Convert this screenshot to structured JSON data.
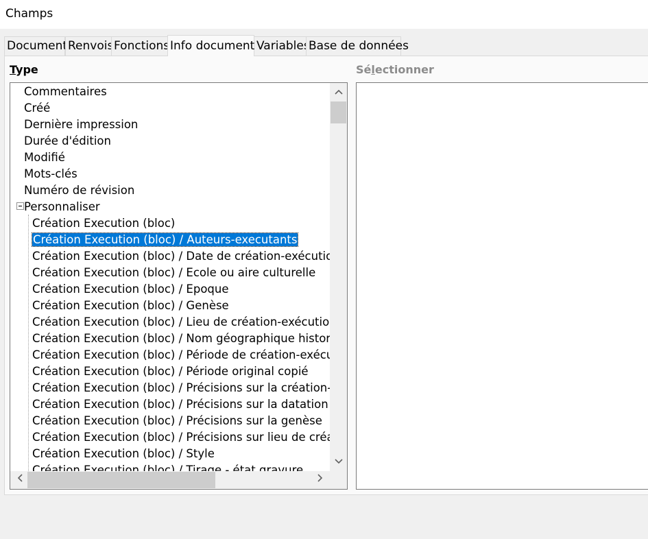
{
  "window": {
    "title": "Champs"
  },
  "tabs": [
    {
      "label": "Document"
    },
    {
      "label": "Renvois"
    },
    {
      "label": "Fonctions"
    },
    {
      "label": "Info document"
    },
    {
      "label": "Variables"
    },
    {
      "label": "Base de données"
    }
  ],
  "active_tab": "Info document",
  "type_panel": {
    "label_mnemonic": "T",
    "label_rest": "ype",
    "items": [
      "Commentaires",
      "Créé",
      "Dernière impression",
      "Durée d'édition",
      "Modifié",
      "Mots-clés",
      "Numéro de révision",
      "Personnaliser",
      "Création Execution (bloc)",
      "Création Execution (bloc) / Auteurs-executants",
      "Création Execution (bloc) / Date de création-exécution",
      "Création Execution (bloc) / Ecole ou aire culturelle",
      "Création Execution (bloc) / Epoque",
      "Création Execution (bloc) / Genèse",
      "Création Execution (bloc) / Lieu de création-exécution",
      "Création Execution (bloc) / Nom géographique historiq",
      "Création Execution (bloc) / Période de création-exécutic",
      "Création Execution (bloc) / Période original copié",
      "Création Execution (bloc) / Précisions sur la création-exe",
      "Création Execution (bloc) / Précisions sur la datation",
      "Création Execution (bloc) / Précisions sur la genèse",
      "Création Execution (bloc) / Précisions sur lieu de créatio",
      "Création Execution (bloc) / Style",
      "Création Execution (bloc) / Tirage - état gravure"
    ],
    "selected_item": "Création Execution (bloc) / Auteurs-executants"
  },
  "select_panel": {
    "label_pre": "Sé",
    "label_mnemonic": "l",
    "label_rest": "ectionner"
  },
  "icons": {
    "expander": "collapse-minus-icon",
    "scroll_up": "chevron-up-icon",
    "scroll_down": "chevron-down-icon",
    "scroll_left": "chevron-left-icon",
    "scroll_right": "chevron-right-icon"
  },
  "colors": {
    "selection": "#0078d7",
    "disabled_label": "#8c8c8c"
  }
}
